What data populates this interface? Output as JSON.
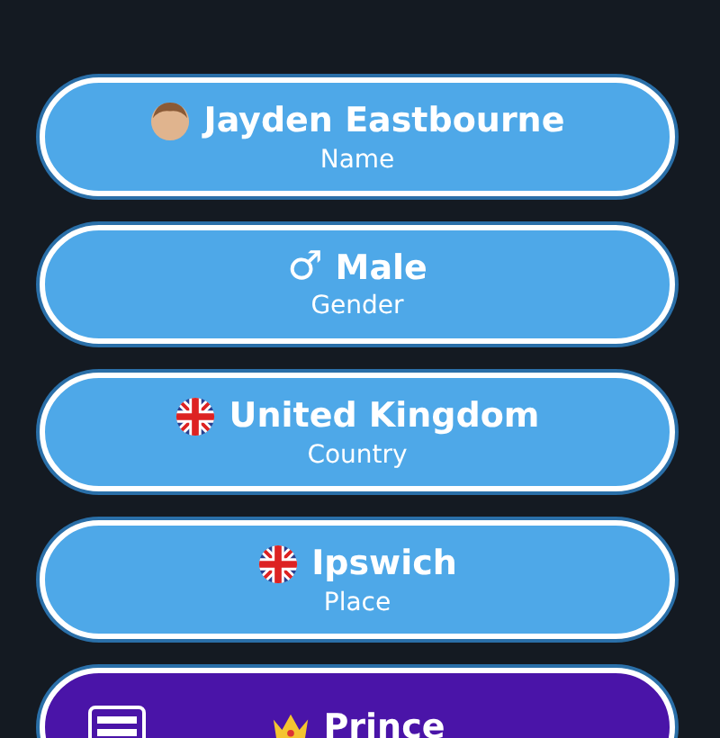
{
  "options": [
    {
      "title": "Jayden Eastbourne",
      "subtitle": "Name",
      "kind": "person",
      "color": "#4ea8e8"
    },
    {
      "title": "Male",
      "subtitle": "Gender",
      "kind": "gender",
      "symbol": "♂",
      "color": "#4ea8e8"
    },
    {
      "title": "United Kingdom",
      "subtitle": "Country",
      "kind": "country",
      "color": "#4ea8e8"
    },
    {
      "title": "Ipswich",
      "subtitle": "Place",
      "kind": "place",
      "color": "#4ea8e8"
    },
    {
      "title": "Prince",
      "kind": "title",
      "badge": true,
      "color": "#4a14a8"
    }
  ]
}
